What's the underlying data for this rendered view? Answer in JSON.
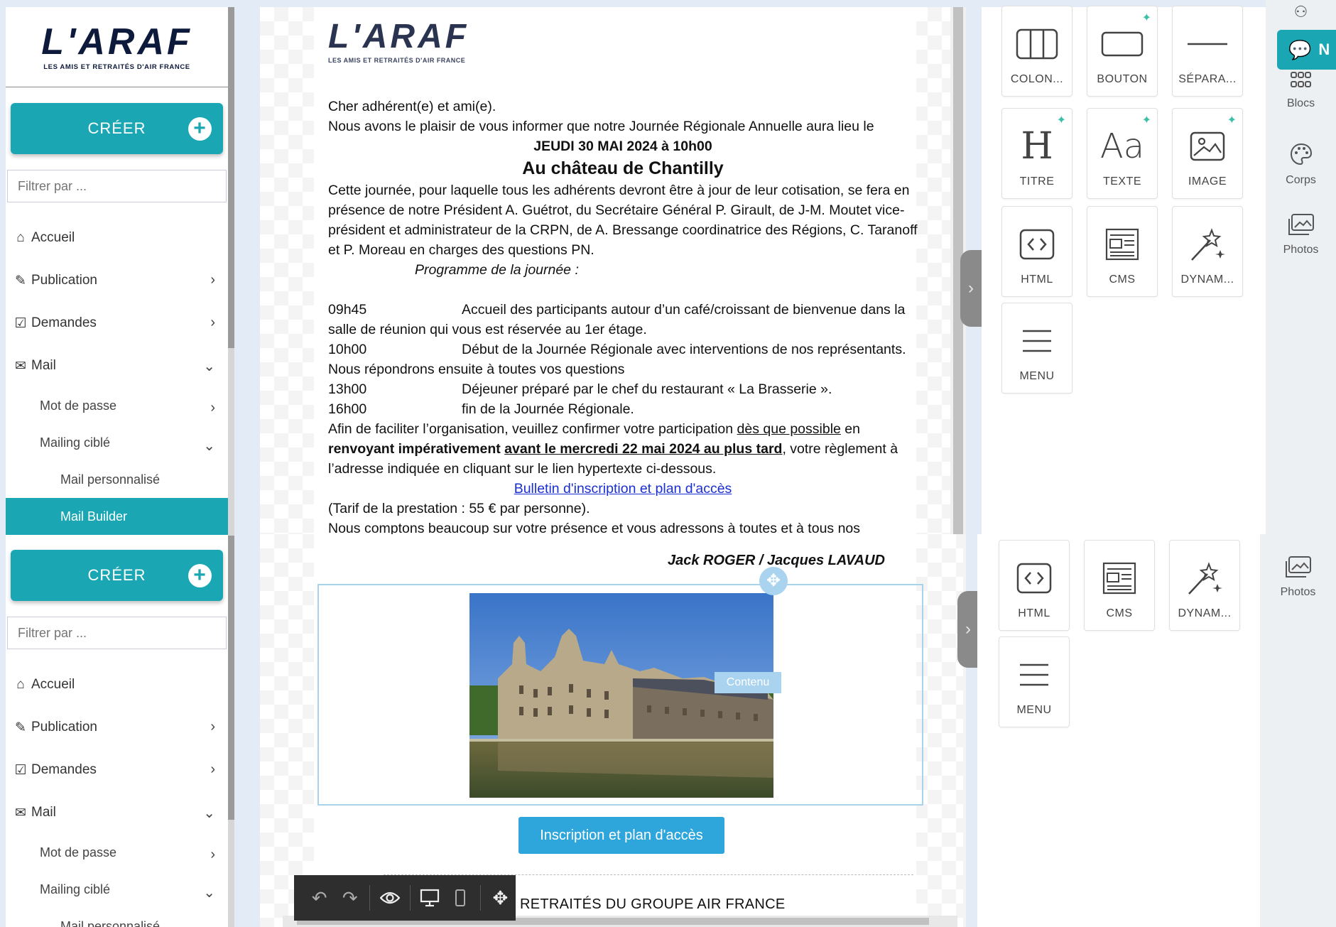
{
  "brand": {
    "logo_main": "L'ARAF",
    "logo_sub": "LES AMIS ET RETRAITÉS D'AIR FRANCE",
    "accent": "#1aa7b3"
  },
  "sidebar": {
    "create_label": "CRÉER",
    "filter_placeholder": "Filtrer par ...",
    "items": [
      {
        "label": "Accueil",
        "icon": "home-icon"
      },
      {
        "label": "Publication",
        "icon": "edit-icon"
      },
      {
        "label": "Demandes",
        "icon": "checkbox-icon"
      },
      {
        "label": "Mail",
        "icon": "envelope-icon"
      },
      {
        "label": "Mot de passe"
      },
      {
        "label": "Mailing ciblé"
      },
      {
        "label": "Mail personnalisé"
      },
      {
        "label": "Mail Builder"
      }
    ]
  },
  "email": {
    "greeting": "Cher adhérent(e) et ami(e).",
    "intro": "Nous avons le plaisir de vous informer que notre Journée Régionale Annuelle aura lieu le",
    "date": "JEUDI 30 MAI 2024 à 10h00",
    "location": "Au château de Chantilly",
    "para1": "Cette journée, pour laquelle tous les adhérents devront être à jour de leur cotisation, se fera en présence de notre Président A. Guétrot, du Secrétaire Général P. Girault, de J-M. Moutet vice-président et administrateur de la CRPN, de A. Bressange coordinatrice des Régions, C. Taranoff et P. Moreau en charges des questions PN.",
    "programme_title": "Programme de la journée :",
    "programme": [
      {
        "time": "09h45",
        "text": "Accueil des participants autour d’un café/croissant de bienvenue dans la",
        "cont": "salle de réunion qui vous est réservée au 1er étage."
      },
      {
        "time": "10h00",
        "text": "Début de la Journée Régionale avec interventions de nos représentants.",
        "cont": "Nous répondrons ensuite à toutes vos questions"
      },
      {
        "time": "13h00",
        "text": "Déjeuner préparé par le chef du restaurant « La Brasserie ».",
        "cont": ""
      },
      {
        "time": "16h00",
        "text": "fin de la Journée Régionale.",
        "cont": ""
      }
    ],
    "confirm_a": "Afin de faciliter l’organisation, veuillez confirmer votre participation ",
    "confirm_u1": "dès que possible",
    "confirm_b": " en ",
    "confirm_bold": "renvoyant impérativement ",
    "confirm_u2": "avant le mercredi 22 mai 2024 au plus tard",
    "confirm_c": ", votre règlement à l’adresse indiquée en cliquant sur le lien hypertexte ci-dessous.",
    "link": "Bulletin d'inscription et plan d'accès",
    "tarif": "(Tarif de la prestation : 55 € par personne).",
    "closing": "Nous comptons beaucoup sur votre présence et vous adressons à toutes et à tous nos",
    "signature": "Jack ROGER / Jacques LAVAUD",
    "button": "Inscription et plan d'accès",
    "contenu_tag": "Contenu",
    "footer": "RETRAITÉS DU GROUPE AIR FRANCE"
  },
  "blocks": {
    "top": [
      {
        "label": "COLON...",
        "icon": "columns-icon",
        "ai": false
      },
      {
        "label": "BOUTON",
        "icon": "button-icon",
        "ai": true
      },
      {
        "label": "SÉPARA...",
        "icon": "separator-icon",
        "ai": false
      },
      {
        "label": "TITRE",
        "icon": "heading-icon",
        "ai": true
      },
      {
        "label": "TEXTE",
        "icon": "text-icon",
        "ai": true
      },
      {
        "label": "IMAGE",
        "icon": "image-icon",
        "ai": true
      },
      {
        "label": "HTML",
        "icon": "code-icon",
        "ai": false
      },
      {
        "label": "CMS",
        "icon": "newspaper-icon",
        "ai": false
      },
      {
        "label": "DYNAM...",
        "icon": "magic-wand-icon",
        "ai": false
      },
      {
        "label": "MENU",
        "icon": "hamburger-icon",
        "ai": false
      }
    ],
    "bottom": [
      {
        "label": "HTML",
        "icon": "code-icon"
      },
      {
        "label": "CMS",
        "icon": "newspaper-icon"
      },
      {
        "label": "DYNAM...",
        "icon": "magic-wand-icon"
      },
      {
        "label": "MENU",
        "icon": "hamburger-icon"
      }
    ]
  },
  "right_nav": {
    "active_letter": "N",
    "items": [
      {
        "label": "Blocs",
        "icon": "grid-icon"
      },
      {
        "label": "Corps",
        "icon": "palette-icon"
      },
      {
        "label": "Photos",
        "icon": "photos-icon"
      }
    ],
    "bottom_items": [
      {
        "label": "Photos",
        "icon": "photos-icon"
      }
    ]
  }
}
